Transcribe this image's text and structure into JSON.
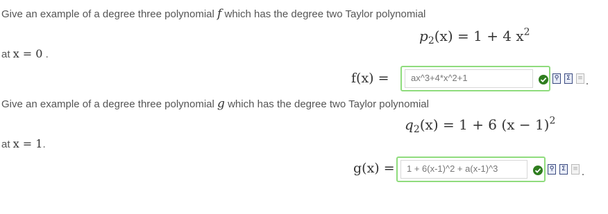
{
  "q1": {
    "prompt_pre": "Give an example of a degree three polynomial",
    "prompt_var": "f",
    "prompt_post": "which has the degree two Taylor polynomial",
    "display_lhs_base": "p",
    "display_lhs_sub": "2",
    "display_lhs_arg": "(x)",
    "display_eq": "=",
    "display_rhs": "1 + 4 x",
    "display_rhs_exp": "2",
    "at_label": "at",
    "at_expr": "x = 0",
    "at_end": ".",
    "answer_label": "f(x) =",
    "answer_value": "ax^3+4*x^2+1"
  },
  "q2": {
    "prompt_pre": "Give an example of a degree three polynomial",
    "prompt_var": "g",
    "prompt_post": "which has the degree two Taylor polynomial",
    "display_lhs_base": "q",
    "display_lhs_sub": "2",
    "display_lhs_arg": "(x)",
    "display_eq": "=",
    "display_rhs": "1 + 6 (x − 1)",
    "display_rhs_exp": "2",
    "at_label": "at",
    "at_expr": "x = 1",
    "at_end": ".",
    "answer_label": "g(x) =",
    "answer_value": "1 + 6(x-1)^2 + a(x-1)^3"
  },
  "icons": [
    "correct-check-icon",
    "preview-icon",
    "equation-editor-icon",
    "help-doc-icon"
  ],
  "colors": {
    "correct_border": "#8fdc7d",
    "check": "#2f7d1f",
    "text": "#555555"
  }
}
